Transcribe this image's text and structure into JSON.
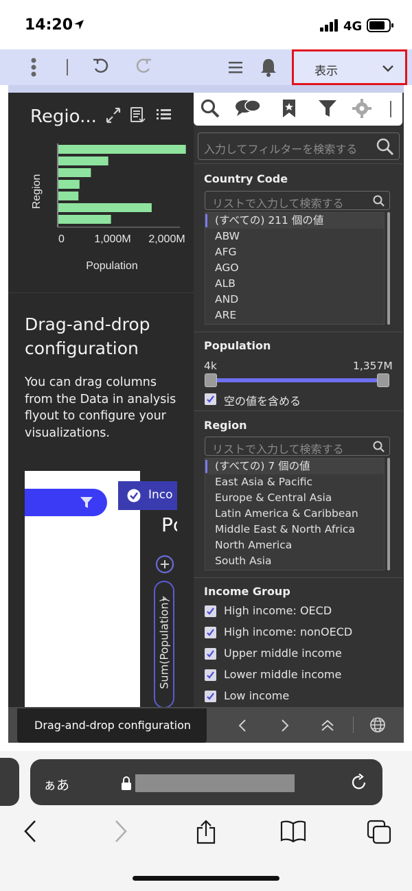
{
  "status_bar": {
    "time": "14:20",
    "network": "4G"
  },
  "toolbar": {
    "view_label": "表示"
  },
  "visualization": {
    "title": "Regio...",
    "chart_data": {
      "type": "bar",
      "orientation": "horizontal",
      "categories": [
        "",
        "",
        "",
        "",
        "",
        "",
        ""
      ],
      "values": [
        2350,
        920,
        600,
        390,
        370,
        1720,
        970
      ],
      "ylabel": "Region",
      "xlabel": "Population",
      "x_ticks": [
        "0",
        "1,000M",
        "2,000M"
      ],
      "xlim": [
        0,
        2500
      ],
      "bar_color": "#8ee39e"
    }
  },
  "tip": {
    "title": "Drag-and-drop configuration",
    "body": "You can drag columns from the Data in analysis flyout to configure your visualizations.",
    "image": {
      "income_label": "Inco",
      "p_label": "Pc",
      "sum_label": "Sum(Population)"
    }
  },
  "filter_panel": {
    "search_placeholder": "入力してフィルターを検索する",
    "country_code": {
      "title": "Country Code",
      "search_placeholder": "リストで入力して検索する",
      "items": [
        "(すべての) 211 個の値",
        "ABW",
        "AFG",
        "AGO",
        "ALB",
        "AND",
        "ARE"
      ]
    },
    "population": {
      "title": "Population",
      "min_label": "4k",
      "max_label": "1,357M",
      "include_empty_label": "空の値を含める"
    },
    "region": {
      "title": "Region",
      "search_placeholder": "リストで入力して検索する",
      "items": [
        "(すべての) 7 個の値",
        "East Asia & Pacific",
        "Europe & Central Asia",
        "Latin America & Caribbean",
        "Middle East & North Africa",
        "North America",
        "South Asia"
      ]
    },
    "income_group": {
      "title": "Income Group",
      "items": [
        "High income: OECD",
        "High income: nonOECD",
        "Upper middle income",
        "Lower middle income",
        "Low income"
      ]
    }
  },
  "bottom_strip": {
    "tooltip": "Drag-and-drop configuration"
  },
  "browser": {
    "aa_label": "ぁあ"
  },
  "colors": {
    "accent": "#6f6ff0",
    "highlight_border": "#e0141c",
    "bar": "#8ee39e"
  }
}
